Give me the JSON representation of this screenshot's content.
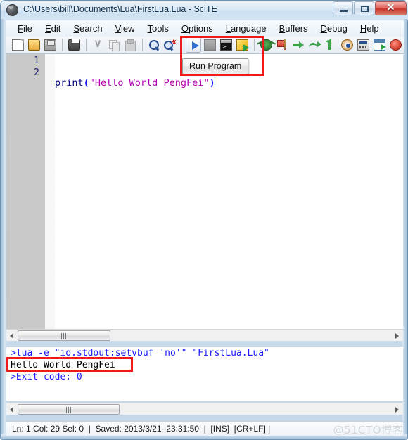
{
  "window": {
    "title": "C:\\Users\\bill\\Documents\\Lua\\FirstLua.Lua - SciTE",
    "app_icon": "scite-globe-icon",
    "minimize_label": "",
    "maximize_label": "",
    "close_label": "✕"
  },
  "menubar": {
    "items": [
      {
        "label": "File",
        "accel": "F"
      },
      {
        "label": "Edit",
        "accel": "E"
      },
      {
        "label": "Search",
        "accel": "S"
      },
      {
        "label": "View",
        "accel": "V"
      },
      {
        "label": "Tools",
        "accel": "T"
      },
      {
        "label": "Options",
        "accel": "O"
      },
      {
        "label": "Language",
        "accel": "L"
      },
      {
        "label": "Buffers",
        "accel": "B"
      },
      {
        "label": "Debug",
        "accel": "D"
      },
      {
        "label": "Help",
        "accel": "H"
      }
    ]
  },
  "toolbar": {
    "buttons": [
      {
        "name": "new-file-icon",
        "tooltip": "New"
      },
      {
        "name": "open-file-icon",
        "tooltip": "Open"
      },
      {
        "name": "save-file-icon",
        "tooltip": "Save"
      },
      {
        "name": "print-icon",
        "tooltip": "Print"
      },
      {
        "name": "cut-icon",
        "tooltip": "Cut"
      },
      {
        "name": "copy-icon",
        "tooltip": "Copy"
      },
      {
        "name": "paste-icon",
        "tooltip": "Paste"
      },
      {
        "name": "find-icon",
        "tooltip": "Find"
      },
      {
        "name": "replace-icon",
        "tooltip": "Replace"
      },
      {
        "name": "run-program-icon",
        "tooltip": "Run Program"
      },
      {
        "name": "stop-execution-icon",
        "tooltip": "Stop"
      },
      {
        "name": "console-icon",
        "tooltip": "Console"
      },
      {
        "name": "build-icon",
        "tooltip": "Build"
      },
      {
        "name": "debug-bug-icon",
        "tooltip": "Debug"
      },
      {
        "name": "breakpoint-flag-icon",
        "tooltip": "Breakpoint"
      },
      {
        "name": "step-into-arrow-icon",
        "tooltip": "Step Into"
      },
      {
        "name": "step-over-icon",
        "tooltip": "Step Over"
      },
      {
        "name": "step-out-icon",
        "tooltip": "Step Out"
      },
      {
        "name": "watch-eye-icon",
        "tooltip": "Watch"
      },
      {
        "name": "calculator-icon",
        "tooltip": "Evaluate"
      },
      {
        "name": "go-to-icon",
        "tooltip": "Go To"
      },
      {
        "name": "cancel-icon",
        "tooltip": "Cancel"
      }
    ]
  },
  "tooltip": {
    "text": "Run Program"
  },
  "editor": {
    "line_numbers": [
      "1",
      "2"
    ],
    "lines": [
      {
        "tokens": [
          {
            "text": "print",
            "type": "function"
          },
          {
            "text": "(",
            "type": "paren"
          },
          {
            "text": "\"Hello World PengFei\"",
            "type": "string"
          },
          {
            "text": ")",
            "type": "paren"
          }
        ]
      },
      {
        "tokens": []
      }
    ]
  },
  "output": {
    "lines": [
      {
        "text": ">lua -e \"io.stdout:setvbuf 'no'\" \"FirstLua.Lua\"",
        "type": "command"
      },
      {
        "text": "Hello World PengFei",
        "type": "stdout"
      },
      {
        "text": ">Exit code: 0",
        "type": "command"
      }
    ]
  },
  "statusbar": {
    "text": "Ln: 1 Col: 29 Sel: 0  |  Saved: 2013/3/21  23:31:50  |  [INS]  [CR+LF] |"
  },
  "watermark": {
    "text": "@51CTO博客"
  },
  "highlights": {
    "toolbar_box": "red-highlight-rect",
    "output_box": "red-highlight-rect"
  },
  "colors": {
    "accent_red": "#ef1b1b",
    "code_function": "#00007f",
    "code_paren": "#1a1aff",
    "code_string": "#b000b0",
    "output_command": "#1a1aff",
    "output_stdout": "#000000",
    "linenumber": "#202080",
    "titlebar_text": "#0c3050"
  }
}
